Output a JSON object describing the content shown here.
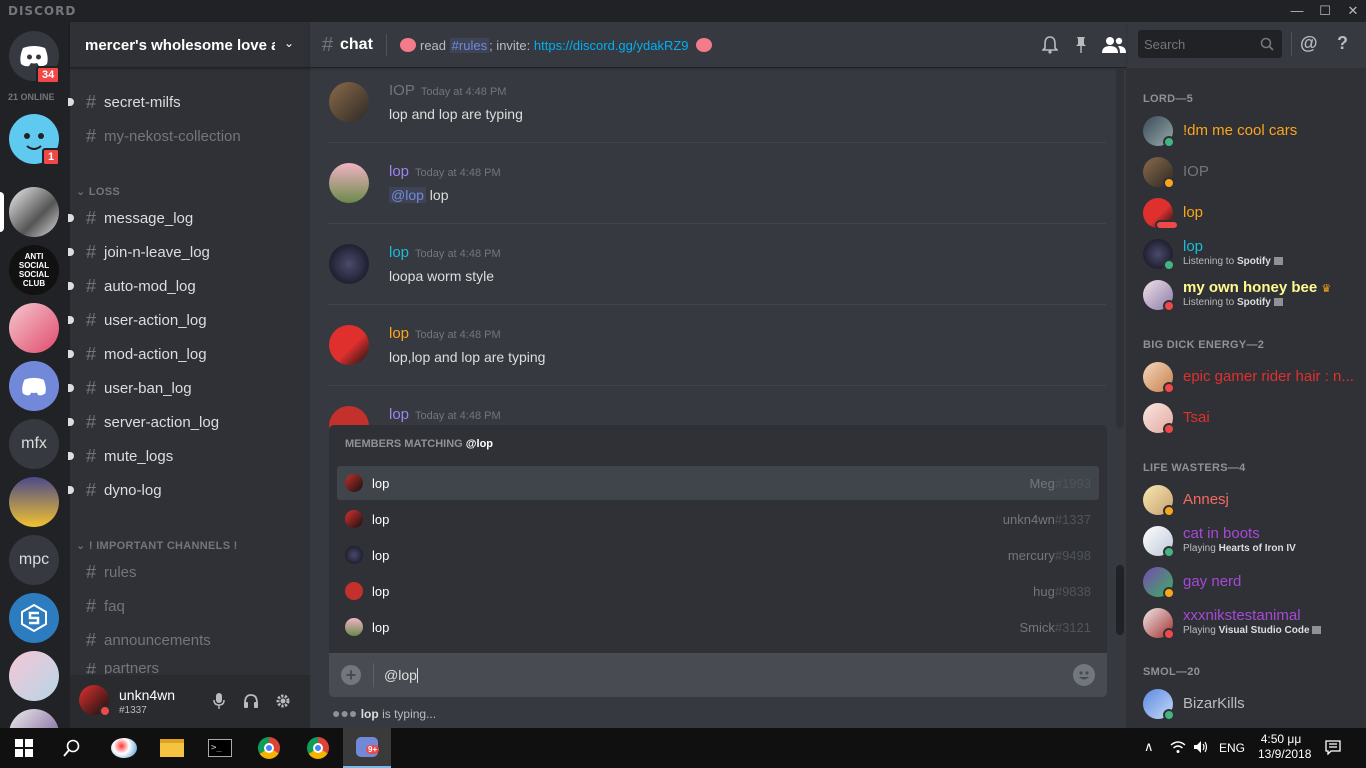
{
  "window": {
    "brand": "DISCORD"
  },
  "guilds": {
    "online_label": "21 ONLINE",
    "home_badge": "34",
    "second_badge": "1",
    "text_guilds": [
      {
        "label": "mfx"
      },
      {
        "label": "mpc"
      }
    ]
  },
  "server": {
    "name": "mercer's wholesome love a...",
    "channels_top": [
      {
        "name": "secret-milfs"
      },
      {
        "name": "my-nekost-collection"
      }
    ],
    "category_loss": "LOSS",
    "loss_channels": [
      {
        "name": "message_log"
      },
      {
        "name": "join-n-leave_log"
      },
      {
        "name": "auto-mod_log"
      },
      {
        "name": "user-action_log"
      },
      {
        "name": "mod-action_log"
      },
      {
        "name": "user-ban_log"
      },
      {
        "name": "server-action_log"
      },
      {
        "name": "mute_logs"
      },
      {
        "name": "dyno-log"
      }
    ],
    "category_important": "! IMPORTANT CHANNELS !",
    "important_channels": [
      {
        "name": "rules"
      },
      {
        "name": "faq"
      },
      {
        "name": "announcements"
      },
      {
        "name": "partners"
      }
    ]
  },
  "user_panel": {
    "name": "unkn4wn",
    "tag": "#1337"
  },
  "chat_header": {
    "channel": "chat",
    "topic_prefix": "read",
    "topic_channel": "#rules",
    "topic_mid": "; invite:",
    "topic_link": "https://discord.gg/ydakRZ9",
    "search_placeholder": "Search"
  },
  "messages": [
    {
      "author": "IOP",
      "timestamp": "Today at 4:48 PM",
      "text": "lop and lop are typing",
      "color": "#72767d"
    },
    {
      "author": "lop",
      "timestamp": "Today at 4:48 PM",
      "mention": "@lop",
      "text": "lop",
      "color": "#9b84ee"
    },
    {
      "author": "lop",
      "timestamp": "Today at 4:48 PM",
      "text": "loopa worm style",
      "color": "#1abcd8"
    },
    {
      "author": "lop",
      "timestamp": "Today at 4:48 PM",
      "text": "lop,lop and lop are typing",
      "color": "#faa61a"
    },
    {
      "author": "lop",
      "timestamp": "Today at 4:48 PM",
      "text": "",
      "color": "#9b84ee"
    }
  ],
  "autocomplete": {
    "title": "MEMBERS MATCHING",
    "query": "@lop",
    "items": [
      {
        "name": "lop",
        "user": "Meg",
        "disc": "#1993"
      },
      {
        "name": "lop",
        "user": "unkn4wn",
        "disc": "#1337"
      },
      {
        "name": "lop",
        "user": "mercury",
        "disc": "#9498"
      },
      {
        "name": "lop",
        "user": "hug",
        "disc": "#9838"
      },
      {
        "name": "lop",
        "user": "Smick",
        "disc": "#3121"
      }
    ]
  },
  "composer": {
    "value": "@lop"
  },
  "typing": {
    "who": "lop",
    "text": "is typing..."
  },
  "members": {
    "categories": [
      {
        "title": "LORD—5"
      },
      {
        "title": "BIG DICK ENERGY—2"
      },
      {
        "title": "LIFE WASTERS—4"
      },
      {
        "title": "SMOL—20"
      }
    ],
    "list": [
      {
        "name": "!dm me cool cars",
        "color": "#faa61a"
      },
      {
        "name": "IOP",
        "color": "#72767d"
      },
      {
        "name": "lop",
        "color": "#faa61a"
      },
      {
        "name": "lop",
        "color": "#1abcd8",
        "activity_prefix": "Listening to",
        "activity": "Spotify"
      },
      {
        "name": "my own honey bee",
        "color": "#fffb8f",
        "activity_prefix": "Listening to",
        "activity": "Spotify"
      },
      {
        "name": "epic gamer rider hair : n...",
        "color": "#e0302e"
      },
      {
        "name": "Tsai",
        "color": "#e0302e"
      },
      {
        "name": "Annesj",
        "color": "#f46b5f"
      },
      {
        "name": "cat in boots",
        "color": "#a749d6",
        "activity_prefix": "Playing",
        "activity": "Hearts of Iron IV"
      },
      {
        "name": "gay nerd",
        "color": "#a749d6"
      },
      {
        "name": "xxxnikstestanimal",
        "color": "#a749d6",
        "activity_prefix": "Playing",
        "activity": "Visual Studio Code"
      },
      {
        "name": "BizarKills",
        "color": "#b9bbbe"
      }
    ]
  },
  "taskbar": {
    "lang": "ENG",
    "time": "4:50 μμ",
    "date": "13/9/2018",
    "discord_badge": "9+"
  }
}
